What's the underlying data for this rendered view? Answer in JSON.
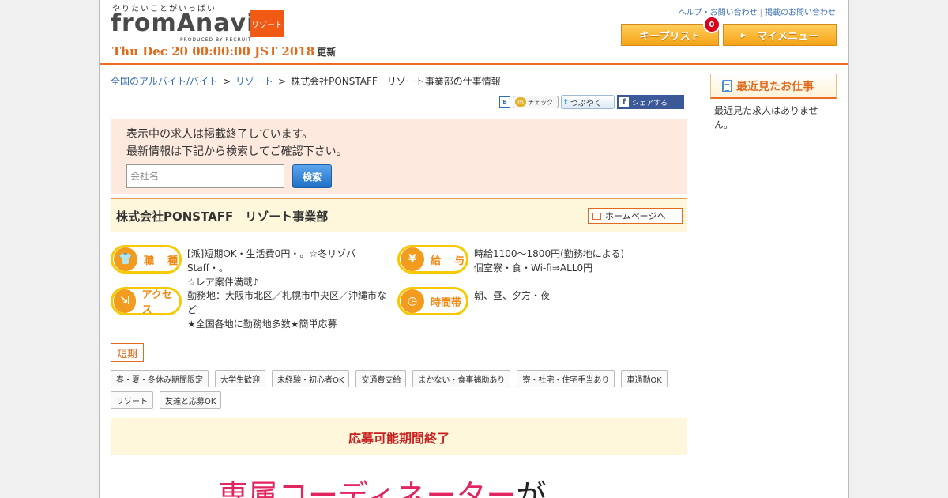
{
  "header": {
    "logo_tagline": "やりたいことがいっぱい",
    "logo_text": "fromAnavi",
    "logo_produced": "PRODUCED BY RECRUIT",
    "category_badge": "リゾート",
    "updated_date": "Thu Dec 20 00:00:00 JST 2018",
    "updated_suffix": "更新",
    "help_link": "ヘルプ・お問い合わせ",
    "publish_link": "掲載のお問い合わせ",
    "keeplist_label": "キープリスト",
    "keeplist_count": "0",
    "mymenu_label": "マイメニュー",
    "colors": {
      "accent": "#ec6b29",
      "button": "#f6a317"
    }
  },
  "breadcrumb": {
    "items": [
      "全国のアルバイト/バイト",
      "リゾート",
      "株式会社PONSTAFF　リゾート事業部の仕事情報"
    ],
    "separator": ">"
  },
  "social": {
    "hatena": "B",
    "mixi_check": "チェック",
    "tweet": "つぶやく",
    "facebook_share": "シェアする"
  },
  "notice": {
    "line1": "表示中の求人は掲載終了しています。",
    "line2": "最新情報は下記から検索してご確認下さい。",
    "input_placeholder": "会社名",
    "input_value": "",
    "search_button": "検索"
  },
  "company": {
    "name": "株式会社PONSTAFF　リゾート事業部",
    "homepage_button": "ホームページへ"
  },
  "info": {
    "job_type": {
      "label": "職　種",
      "value_line1": "[派]短期OK・生活費0円・。☆冬リゾバStaff・。",
      "value_line2": "☆レア案件満載♪"
    },
    "salary": {
      "label": "給　与",
      "value_line1": "時給1100～1800円(勤務地による)",
      "value_line2": "個室寮・食・Wi-fi⇒ALL0円"
    },
    "access": {
      "label": "アクセス",
      "value_line1": "勤務地：大阪市北区／札幌市中央区／沖縄市な",
      "value_line2": "ど",
      "value_line3": "★全国各地に勤務地多数★簡単応募"
    },
    "hours": {
      "label": "時間帯",
      "value_line1": "朝、昼、夕方・夜"
    }
  },
  "tags": {
    "primary": "短期",
    "items": [
      "春・夏・冬休み期間限定",
      "大学生歓迎",
      "未経験・初心者OK",
      "交通費支給",
      "まかない・食事補助あり",
      "寮・社宅・住宅手当あり",
      "車通勤OK",
      "リゾート",
      "友達と応募OK"
    ]
  },
  "ended": {
    "text": "応募可能期間終了"
  },
  "big_heading": {
    "pink": "専属コーディネーター",
    "black": "が"
  },
  "sidebar": {
    "title": "最近見たお仕事",
    "empty_text": "最近見た求人はありません。"
  }
}
